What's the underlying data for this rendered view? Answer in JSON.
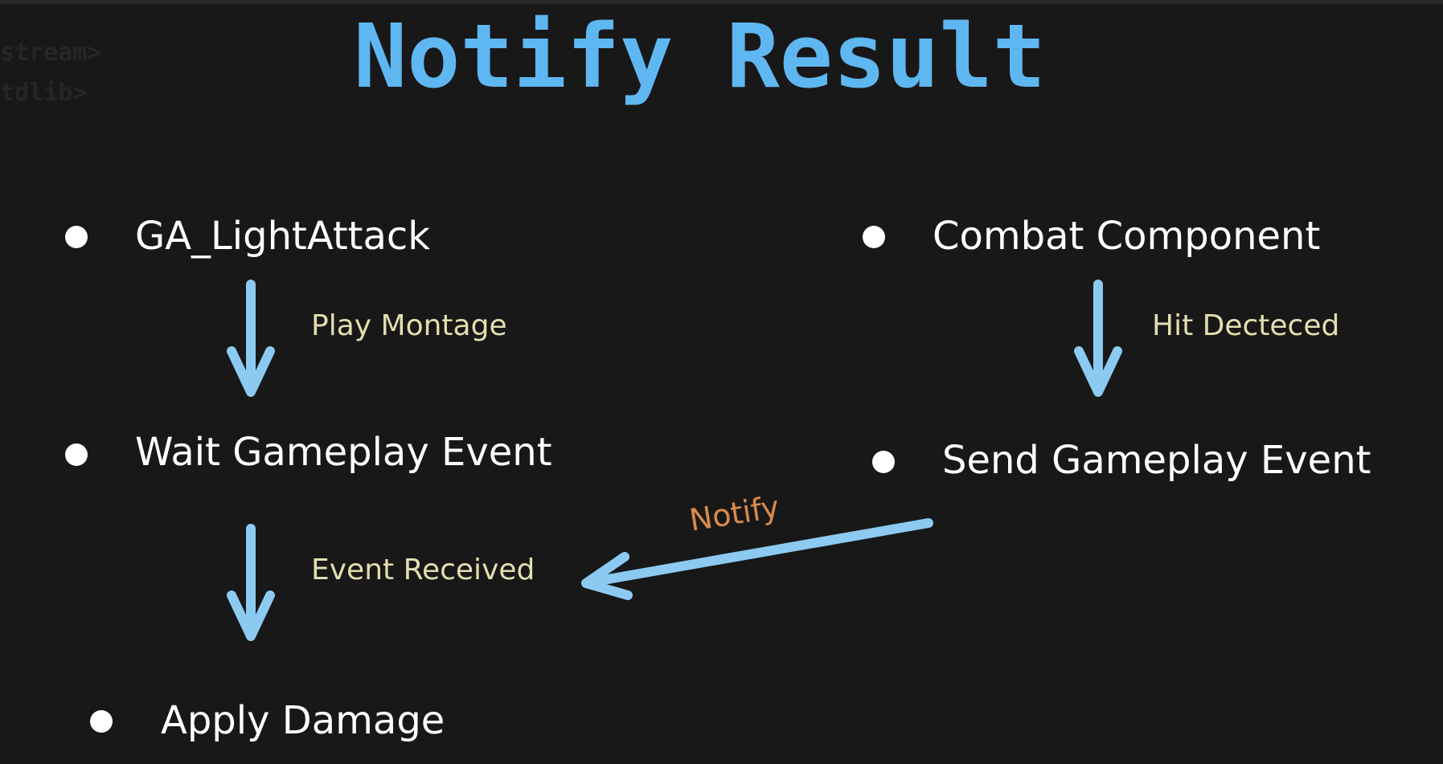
{
  "background_code": {
    "line1": "stream>",
    "line2": "tdlib>"
  },
  "title": "Notify Result",
  "nodes": {
    "ga_light_attack": "GA_LightAttack",
    "wait_gameplay_event": "Wait Gameplay Event",
    "apply_damage": "Apply Damage",
    "combat_component": "Combat Component",
    "send_gameplay_event": "Send Gameplay Event"
  },
  "edges": {
    "play_montage": "Play Montage",
    "event_received": "Event Received",
    "hit_detected": "Hit Decteced",
    "notify": "Notify"
  },
  "colors": {
    "background": "#181818",
    "title": "#5fb7f2",
    "arrow": "#8ccaf2",
    "edge_label": "#e3deaf",
    "notify_label": "#d98a4b",
    "node_text": "#ffffff"
  }
}
